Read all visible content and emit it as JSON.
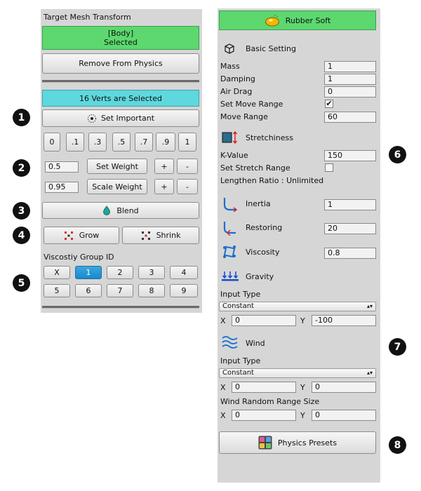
{
  "left": {
    "title": "Target Mesh Transform",
    "selection_name": "[Body]",
    "selection_status": "Selected",
    "remove_button": "Remove From Physics",
    "verts_selected": "16 Verts are Selected",
    "set_important": "Set Important",
    "weight_presets": [
      "0",
      ".1",
      ".3",
      ".5",
      ".7",
      ".9",
      "1"
    ],
    "set_weight_value": "0.5",
    "set_weight_label": "Set Weight",
    "scale_weight_value": "0.95",
    "scale_weight_label": "Scale Weight",
    "plus": "+",
    "minus": "-",
    "blend": "Blend",
    "grow": "Grow",
    "shrink": "Shrink",
    "viscosity_group_title": "Viscostiy Group ID",
    "viscosity_groups": [
      "X",
      "1",
      "2",
      "3",
      "4",
      "5",
      "6",
      "7",
      "8",
      "9"
    ],
    "viscosity_selected": "1"
  },
  "right": {
    "preset_name": "Rubber Soft",
    "basic_title": "Basic Setting",
    "mass_label": "Mass",
    "mass_value": "1",
    "damping_label": "Damping",
    "damping_value": "1",
    "air_drag_label": "Air Drag",
    "air_drag_value": "0",
    "set_move_range_label": "Set Move Range",
    "set_move_range_checked": "✔",
    "move_range_label": "Move Range",
    "move_range_value": "60",
    "stretch_title": "Stretchiness",
    "k_value_label": "K-Value",
    "k_value": "150",
    "set_stretch_range_label": "Set Stretch Range",
    "lengthen_ratio": "Lengthen Ratio : Unlimited",
    "inertia_label": "Inertia",
    "inertia_value": "1",
    "restoring_label": "Restoring",
    "restoring_value": "20",
    "viscosity_label": "Viscosity",
    "viscosity_value": "0.8",
    "gravity_title": "Gravity",
    "gravity_input_type_label": "Input Type",
    "gravity_input_type": "Constant",
    "gravity_x_label": "X",
    "gravity_x": "0",
    "gravity_y_label": "Y",
    "gravity_y": "-100",
    "wind_title": "Wind",
    "wind_input_type_label": "Input Type",
    "wind_input_type": "Constant",
    "wind_x_label": "X",
    "wind_x": "0",
    "wind_y_label": "Y",
    "wind_y": "0",
    "wind_random_label": "Wind Random Range Size",
    "wind_random_x_label": "X",
    "wind_random_x": "0",
    "wind_random_y_label": "Y",
    "wind_random_y": "0",
    "physics_presets": "Physics Presets"
  },
  "callouts": [
    "1",
    "2",
    "3",
    "4",
    "5",
    "6",
    "7",
    "8"
  ],
  "colors": {
    "selected_green": "#5cd86f",
    "verts_cyan": "#5fd8dd",
    "selected_blue": "#1889cc",
    "panel_gray": "#d6d6d6"
  }
}
